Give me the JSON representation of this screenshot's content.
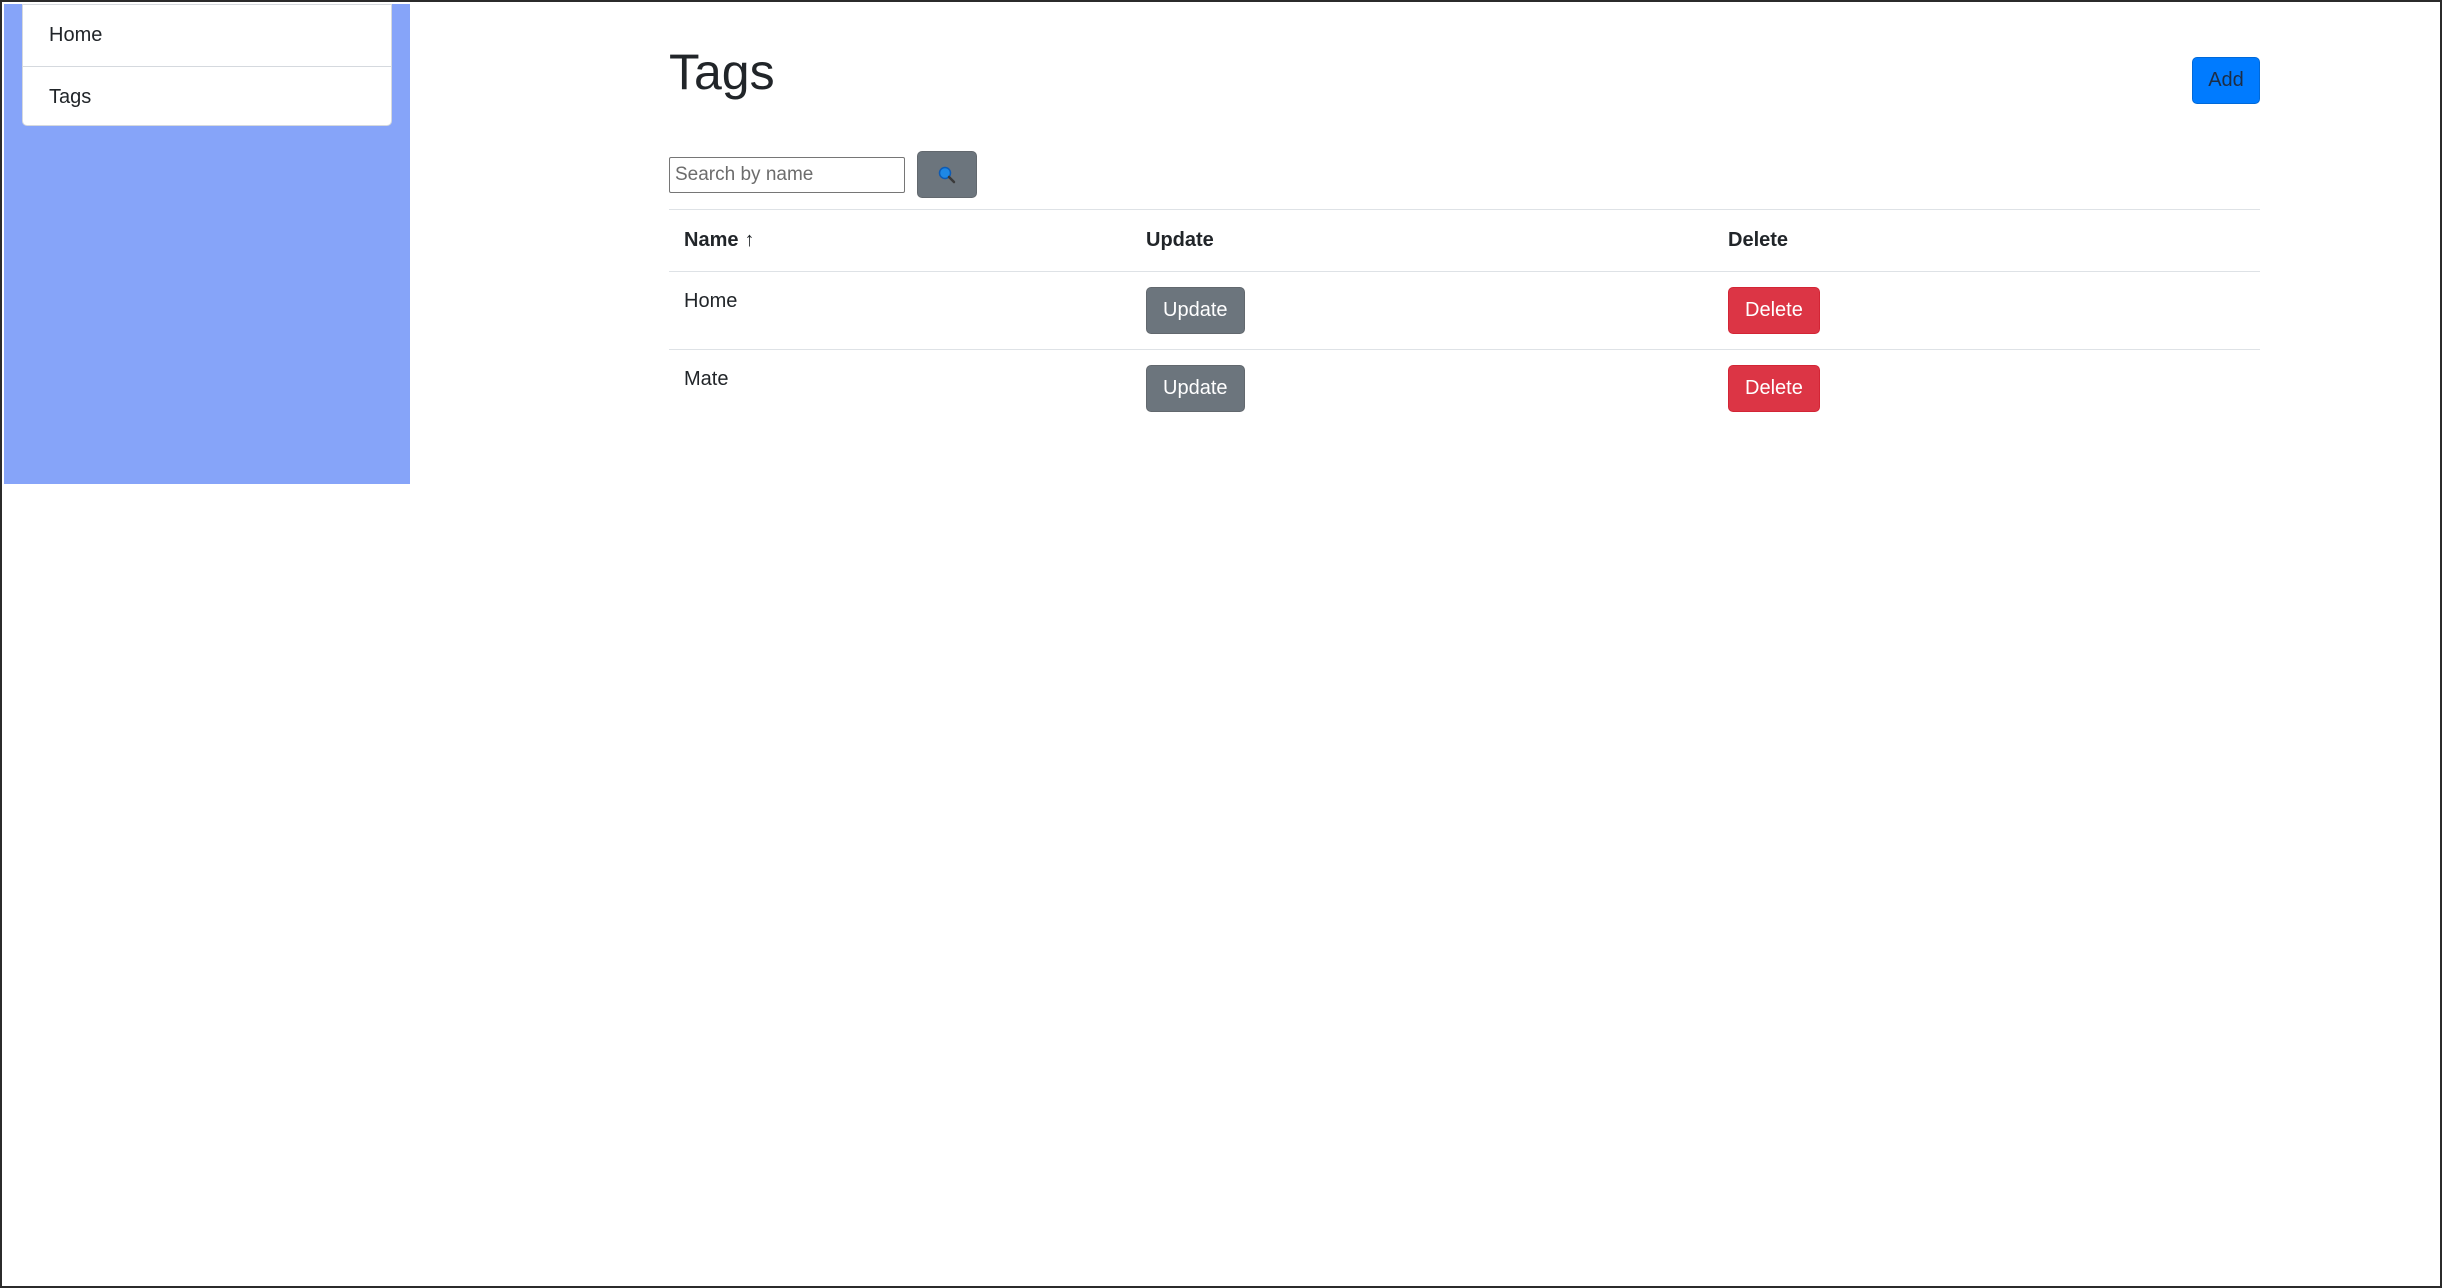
{
  "colors": {
    "sidebar_bg": "#86a4f9",
    "primary": "#007bff",
    "secondary": "#6c757d",
    "danger": "#dc3545"
  },
  "sidebar": {
    "items": [
      {
        "label": "Home"
      },
      {
        "label": "Tags"
      }
    ]
  },
  "header": {
    "title": "Tags",
    "add_label": "Add"
  },
  "search": {
    "placeholder": "Search by name",
    "value": "",
    "button_icon": "search-icon"
  },
  "table": {
    "columns": [
      {
        "label": "Name",
        "sort_indicator": "↑"
      },
      {
        "label": "Update"
      },
      {
        "label": "Delete"
      }
    ],
    "rows": [
      {
        "name": "Home",
        "update_label": "Update",
        "delete_label": "Delete"
      },
      {
        "name": "Mate",
        "update_label": "Update",
        "delete_label": "Delete"
      }
    ]
  }
}
